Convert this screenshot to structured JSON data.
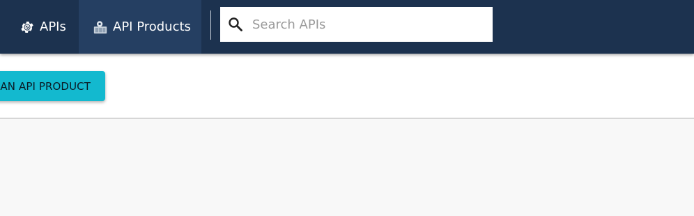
{
  "topbar": {
    "background_color": "#1c324f",
    "active_tab_color": "#253f62",
    "tabs": [
      {
        "label": "APIs",
        "icon": "gear-icon",
        "active": false
      },
      {
        "label": "API Products",
        "icon": "api-product-icon",
        "active": true
      }
    ]
  },
  "search": {
    "placeholder": "Search APIs",
    "value": "",
    "icon": "search-icon"
  },
  "toolbar": {
    "create_button_label": "AN API PRODUCT",
    "create_button_color": "#13b9cf"
  }
}
